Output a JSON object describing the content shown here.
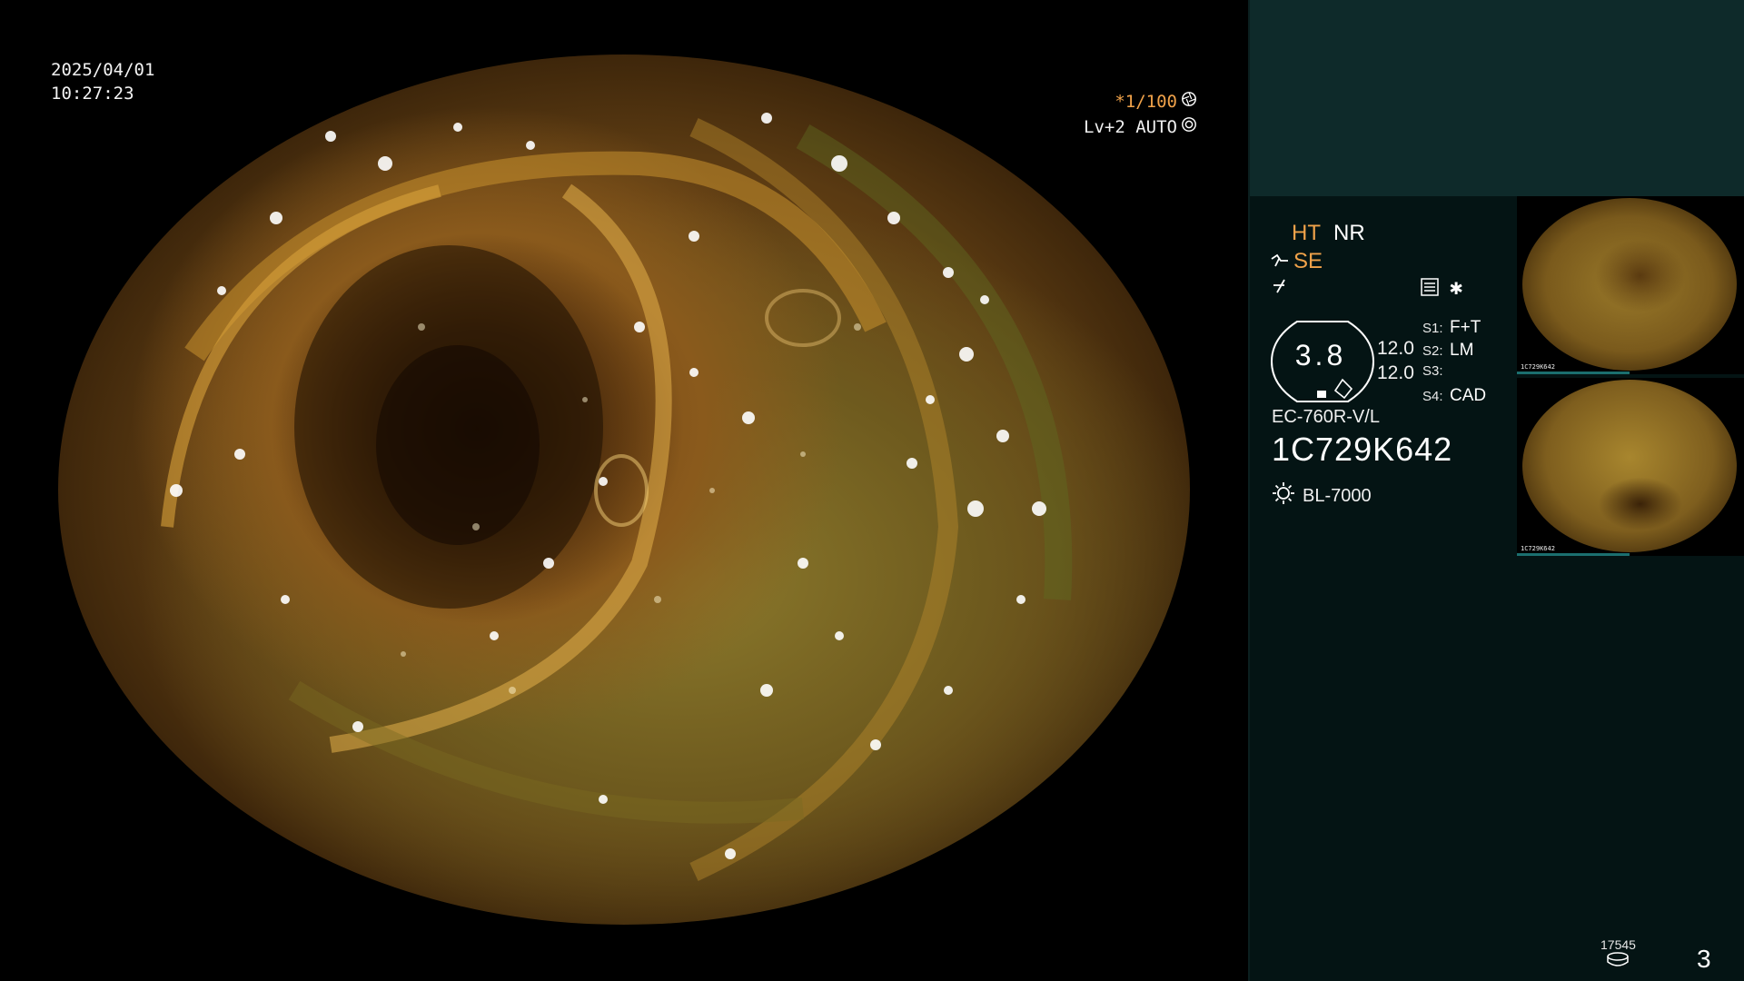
{
  "overlay": {
    "date": "2025/04/01",
    "time": "10:27:23",
    "shutter": "*1/100",
    "iris": "Lv+2 AUTO"
  },
  "panel": {
    "mode_ht": "HT",
    "mode_nr": "NR",
    "mode_se": "SE",
    "gauge_value": "3.8",
    "gauge_num_1": "12.0",
    "gauge_num_2": "12.0",
    "switches": [
      {
        "key": "S1:",
        "value": "F+T"
      },
      {
        "key": "S2:",
        "value": "LM"
      },
      {
        "key": "S3:",
        "value": ""
      },
      {
        "key": "S4:",
        "value": "CAD"
      }
    ],
    "scope_model": "EC-760R-V/L",
    "scope_serial": "1C729K642",
    "light_source": "BL-7000",
    "storage_count": "17545",
    "page_number": "3"
  },
  "thumbnails": [
    {
      "label": "1C729K642"
    },
    {
      "label": "1C729K642"
    }
  ],
  "colors": {
    "accent_orange": "#f0a24a",
    "panel_bg": "#041414",
    "panel_top_bg": "#0e2a2a",
    "thumb_bar": "#1b6f6f"
  },
  "icons": {
    "shutter": "aperture-icon",
    "iris": "iris-icon",
    "light": "sun-icon",
    "menu": "menu-icon",
    "storage": "disk-icon"
  }
}
